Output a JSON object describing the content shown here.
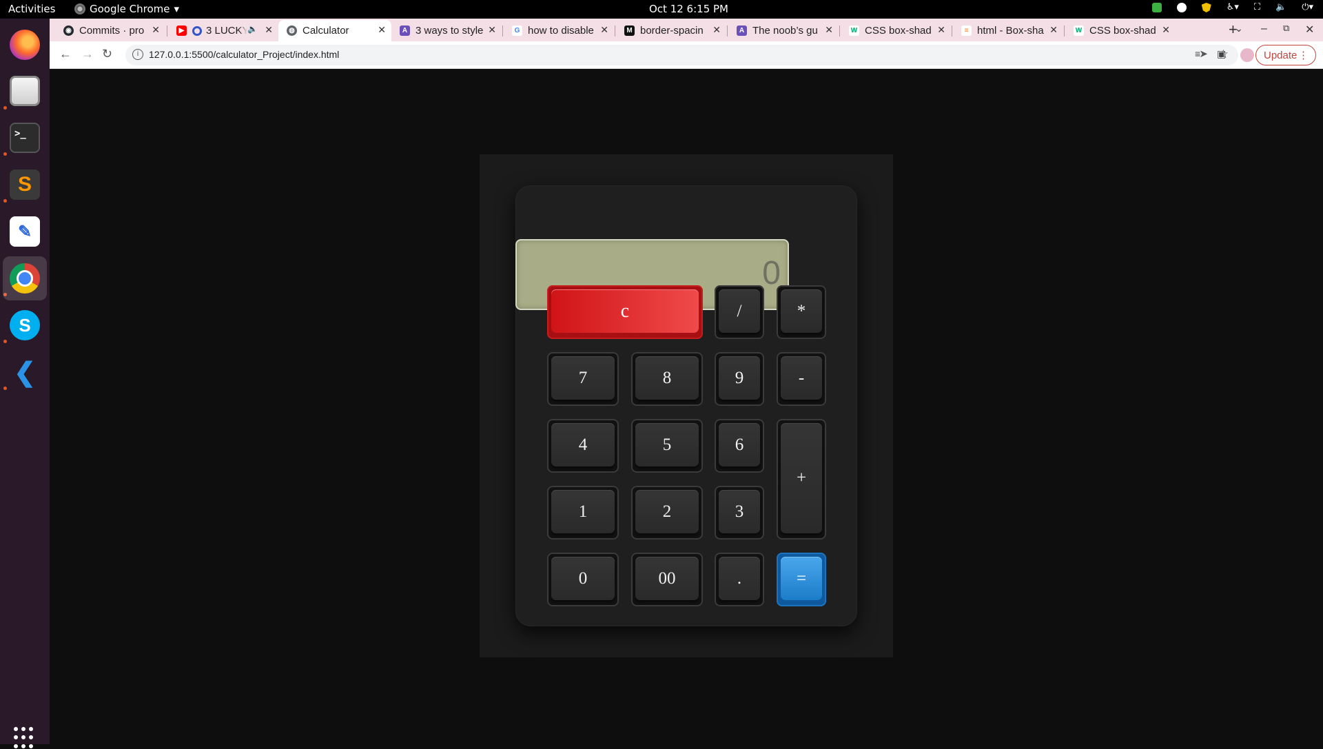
{
  "topbar": {
    "activities": "Activities",
    "app_name": "Google Chrome",
    "clock": "Oct 12  6:15 PM"
  },
  "dock": {
    "apps": [
      {
        "name": "Firefox",
        "icon": "firefox-icon"
      },
      {
        "name": "Files",
        "icon": "files-icon"
      },
      {
        "name": "Terminal",
        "icon": "terminal-icon"
      },
      {
        "name": "Sublime Text",
        "icon": "sublime-icon"
      },
      {
        "name": "Text Editor",
        "icon": "text-editor-icon"
      },
      {
        "name": "Google Chrome",
        "icon": "chrome-icon"
      },
      {
        "name": "Skype",
        "icon": "skype-icon"
      },
      {
        "name": "Visual Studio Code",
        "icon": "vscode-icon"
      }
    ],
    "terminal_glyph": ">_",
    "sublime_glyph": "S",
    "editor_glyph": "✎",
    "skype_glyph": "S",
    "vscode_glyph": "❮"
  },
  "tabs": [
    {
      "label": "Commits · pro",
      "favicon_color": "#24292f",
      "favicon_glyph": "◉"
    },
    {
      "label": "3 LUCKY",
      "favicon_color": "#ff0000",
      "favicon_glyph": "▶"
    },
    {
      "label": "Calculator",
      "favicon_color": "#5f6368",
      "favicon_glyph": "◍"
    },
    {
      "label": "3 ways to style",
      "favicon_color": "#6b4fbb",
      "favicon_glyph": "A"
    },
    {
      "label": "how to disable",
      "favicon_color": "#4285f4",
      "favicon_glyph": "G"
    },
    {
      "label": "border-spacin",
      "favicon_color": "#111111",
      "favicon_glyph": "M"
    },
    {
      "label": "The noob’s gu",
      "favicon_color": "#6b4fbb",
      "favicon_glyph": "A"
    },
    {
      "label": "CSS box-shad",
      "favicon_color": "#04aa6d",
      "favicon_glyph": "W"
    },
    {
      "label": "html - Box-sha",
      "favicon_color": "#f48024",
      "favicon_glyph": "≡"
    },
    {
      "label": "CSS box-shad",
      "favicon_color": "#04aa6d",
      "favicon_glyph": "W"
    }
  ],
  "toolbar": {
    "url": "127.0.0.1:5500/calculator_Project/index.html",
    "update_label": "Update",
    "info_glyph": "i",
    "star_glyph": "☆",
    "send_glyph": "➤"
  },
  "calculator": {
    "display_value": "0",
    "keys": {
      "clear": "c",
      "divide": "/",
      "multiply": "*",
      "seven": "7",
      "eight": "8",
      "nine": "9",
      "minus": "-",
      "four": "4",
      "five": "5",
      "six": "6",
      "plus": "+",
      "one": "1",
      "two": "2",
      "three": "3",
      "zero": "0",
      "double_zero": "00",
      "decimal": ".",
      "equals": "="
    },
    "colors": {
      "display_bg": "#a9ad87",
      "clear_key": "#d01417",
      "equals_key": "#1b7cc8"
    }
  }
}
